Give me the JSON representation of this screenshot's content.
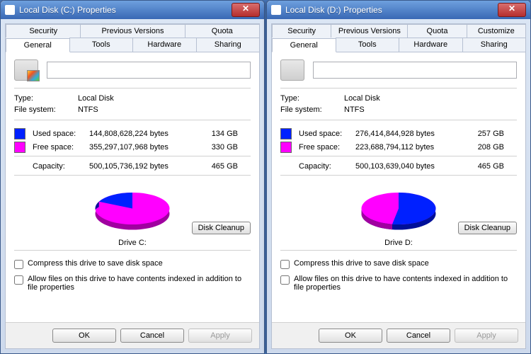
{
  "dialogs": {
    "c": {
      "title": "Local Disk (C:) Properties",
      "drive_label": "Drive C:"
    },
    "d": {
      "title": "Local Disk (D:) Properties",
      "drive_label": "Drive D:"
    }
  },
  "tabs": {
    "security": "Security",
    "previous": "Previous Versions",
    "quota": "Quota",
    "customize": "Customize",
    "general": "General",
    "tools": "Tools",
    "hardware": "Hardware",
    "sharing": "Sharing"
  },
  "labels": {
    "type": "Type:",
    "filesystem": "File system:",
    "used": "Used space:",
    "free": "Free space:",
    "capacity": "Capacity:",
    "cleanup": "Disk Cleanup",
    "compress": "Compress this drive to save disk space",
    "index": "Allow files on this drive to have contents indexed in addition to file properties",
    "ok": "OK",
    "cancel": "Cancel",
    "apply": "Apply"
  },
  "values": {
    "type": "Local Disk",
    "filesystem": "NTFS"
  },
  "data": {
    "c": {
      "used_bytes": "144,808,628,224 bytes",
      "used_gb": "134 GB",
      "free_bytes": "355,297,107,968 bytes",
      "free_gb": "330 GB",
      "cap_bytes": "500,105,736,192 bytes",
      "cap_gb": "465 GB"
    },
    "d": {
      "used_bytes": "276,414,844,928 bytes",
      "used_gb": "257 GB",
      "free_bytes": "223,688,794,112 bytes",
      "free_gb": "208 GB",
      "cap_bytes": "500,103,639,040 bytes",
      "cap_gb": "465 GB"
    }
  },
  "chart_data": [
    {
      "type": "pie",
      "title": "Drive C:",
      "series": [
        {
          "name": "Used space",
          "value_bytes": 144808628224,
          "value_gb": 134,
          "color": "#0020ff"
        },
        {
          "name": "Free space",
          "value_bytes": 355297107968,
          "value_gb": 330,
          "color": "#ff00ff"
        }
      ],
      "total_bytes": 500105736192,
      "total_gb": 465,
      "used_fraction": 0.29
    },
    {
      "type": "pie",
      "title": "Drive D:",
      "series": [
        {
          "name": "Used space",
          "value_bytes": 276414844928,
          "value_gb": 257,
          "color": "#0020ff"
        },
        {
          "name": "Free space",
          "value_bytes": 223688794112,
          "value_gb": 208,
          "color": "#ff00ff"
        }
      ],
      "total_bytes": 500103639040,
      "total_gb": 465,
      "used_fraction": 0.553
    }
  ],
  "colors": {
    "used": "#0020ff",
    "free": "#ff00ff"
  }
}
